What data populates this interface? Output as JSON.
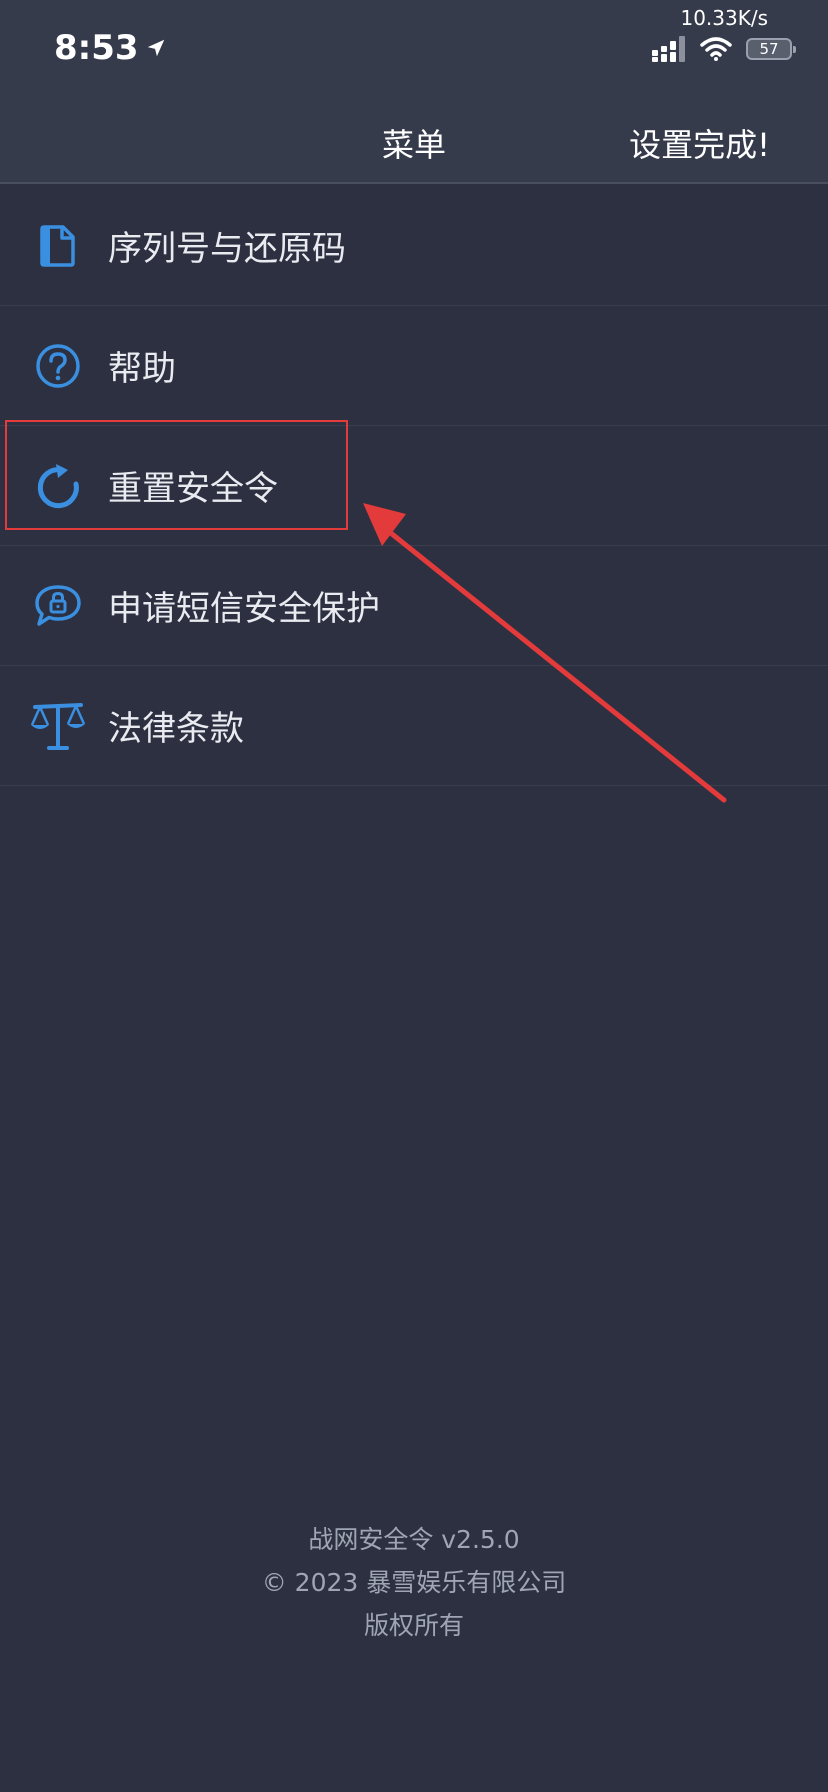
{
  "status_bar": {
    "time": "8:53",
    "net_speed": "10.33K/s",
    "battery": "57"
  },
  "nav": {
    "title": "菜单",
    "done": "设置完成!"
  },
  "menu": {
    "items": [
      {
        "label": "序列号与还原码",
        "icon": "document-icon"
      },
      {
        "label": "帮助",
        "icon": "help-circle-icon"
      },
      {
        "label": "重置安全令",
        "icon": "refresh-icon"
      },
      {
        "label": "申请短信安全保护",
        "icon": "lock-chat-icon"
      },
      {
        "label": "法律条款",
        "icon": "scales-icon"
      }
    ]
  },
  "footer": {
    "app_version": "战网安全令 v2.5.0",
    "copyright": "© 2023 暴雪娱乐有限公司",
    "rights": "版权所有"
  },
  "colors": {
    "background": "#2c3040",
    "header": "#363b4b",
    "icon_blue": "#3a8fe0",
    "annotation_red": "#e33b3b"
  }
}
